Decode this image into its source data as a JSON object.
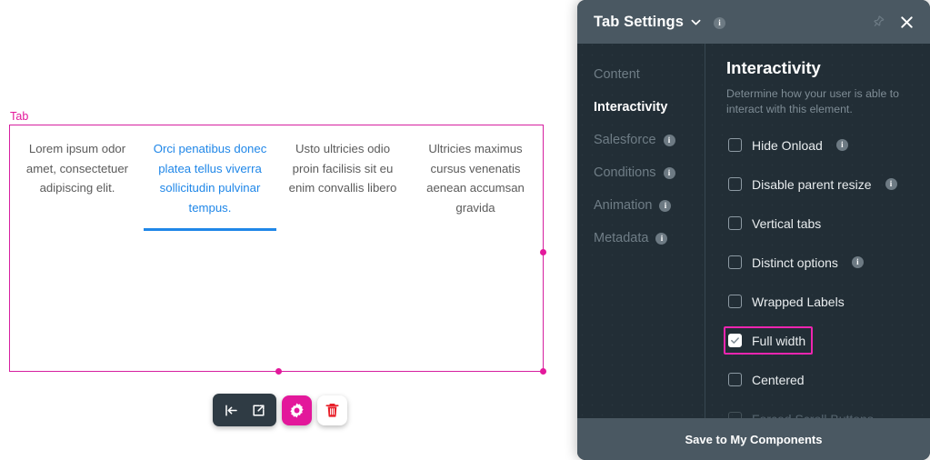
{
  "canvas": {
    "component_label": "Tab",
    "tabs": [
      {
        "text": "Lorem ipsum odor amet, consectetuer adipiscing elit.",
        "active": false
      },
      {
        "text": "Orci penatibus donec platea tellus viverra sollicitudin pulvinar tempus.",
        "active": true
      },
      {
        "text": "Usto ultricies odio proin facilisis sit eu enim convallis libero",
        "active": false
      },
      {
        "text": "Ultricies maximus cursus venenatis aenean accumsan gravida",
        "active": false
      }
    ],
    "toolbar": {
      "move_icon": "move-left-icon",
      "open_icon": "external-link-icon",
      "settings_icon": "gear-icon",
      "delete_icon": "trash-icon"
    },
    "colors": {
      "selection": "#d61fa0",
      "active_tab": "#2087e8",
      "accent": "#e3189b"
    }
  },
  "panel": {
    "header": {
      "title": "Tab Settings",
      "chevron_icon": "chevron-down-icon",
      "info_icon": "info-icon",
      "info_char": "i",
      "pin_icon": "pin-icon",
      "close_icon": "close-icon"
    },
    "nav": [
      {
        "label": "Content",
        "active": false,
        "info": false
      },
      {
        "label": "Interactivity",
        "active": true,
        "info": false
      },
      {
        "label": "Salesforce",
        "active": false,
        "info": true
      },
      {
        "label": "Conditions",
        "active": false,
        "info": true
      },
      {
        "label": "Animation",
        "active": false,
        "info": true
      },
      {
        "label": "Metadata",
        "active": false,
        "info": true
      }
    ],
    "content": {
      "title": "Interactivity",
      "subtitle": "Determine how your user is able to interact with this element.",
      "options": [
        {
          "label": "Hide Onload",
          "checked": false,
          "info": true,
          "disabled": false,
          "highlighted": false
        },
        {
          "label": "Disable parent resize",
          "checked": false,
          "info": true,
          "disabled": false,
          "highlighted": false
        },
        {
          "label": "Vertical tabs",
          "checked": false,
          "info": false,
          "disabled": false,
          "highlighted": false
        },
        {
          "label": "Distinct options",
          "checked": false,
          "info": true,
          "disabled": false,
          "highlighted": false
        },
        {
          "label": "Wrapped Labels",
          "checked": false,
          "info": false,
          "disabled": false,
          "highlighted": false
        },
        {
          "label": "Full width",
          "checked": true,
          "info": false,
          "disabled": false,
          "highlighted": true
        },
        {
          "label": "Centered",
          "checked": false,
          "info": false,
          "disabled": false,
          "highlighted": false
        },
        {
          "label": "Forced Scroll Buttons",
          "checked": false,
          "info": false,
          "disabled": true,
          "highlighted": false
        }
      ]
    },
    "footer": {
      "save_label": "Save to My Components"
    },
    "colors": {
      "background": "#222e36",
      "header": "#4a5862",
      "highlight": "#ee25b0"
    }
  }
}
